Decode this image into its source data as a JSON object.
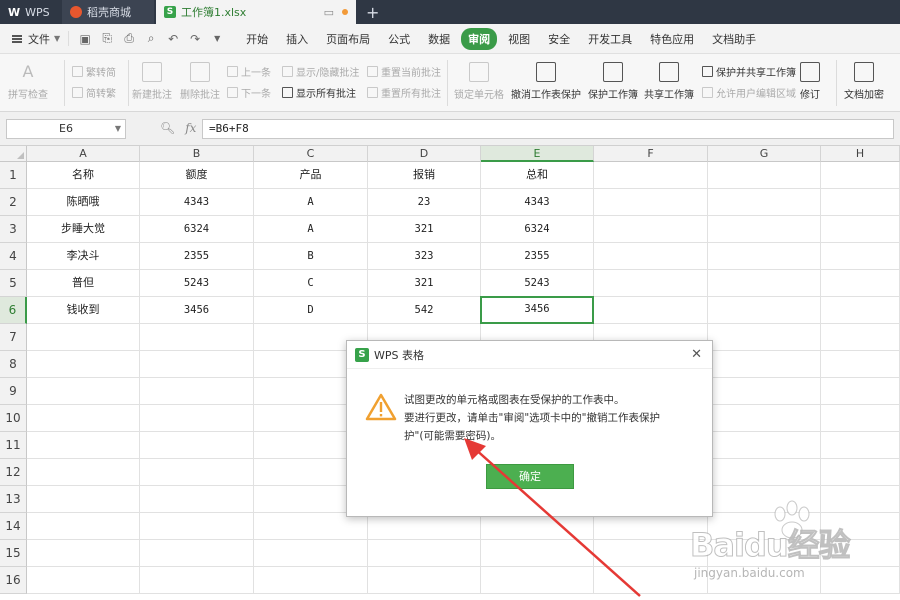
{
  "titlebar": {
    "wps_label": "WPS",
    "store_label": "稻壳商城",
    "doc_label": "工作簿1.xlsx",
    "new_tab_glyph": "+"
  },
  "menubar": {
    "file_label": "文件",
    "items": [
      "开始",
      "插入",
      "页面布局",
      "公式",
      "数据",
      "审阅",
      "视图",
      "安全",
      "开发工具",
      "特色应用",
      "文档助手"
    ],
    "active_index": 5
  },
  "ribbon": {
    "spell_check": "拼写检查",
    "trad_to_simp": "繁转简",
    "simp_to_trad": "简转繁",
    "new_comment": "新建批注",
    "delete_comment": "删除批注",
    "prev_item": "上一条",
    "next_item": "下一条",
    "show_hide_comment": "显示/隐藏批注",
    "show_all_comments": "显示所有批注",
    "reset_current_comment": "重置当前批注",
    "reset_all_comments": "重置所有批注",
    "lock_cell": "锁定单元格",
    "unprotect_sheet": "撤消工作表保护",
    "protect_workbook": "保护工作簿",
    "share_workbook": "共享工作簿",
    "protect_and_share": "保护并共享工作簿",
    "allow_edit_ranges": "允许用户编辑区域",
    "revisions": "修订",
    "encrypt_doc": "文档加密"
  },
  "formula": {
    "name_box": "E6",
    "fx": "fx",
    "value": "=B6+F8"
  },
  "sheet": {
    "columns": [
      "A",
      "B",
      "C",
      "D",
      "E",
      "F",
      "G",
      "H"
    ],
    "row_numbers": [
      "1",
      "2",
      "3",
      "4",
      "5",
      "6",
      "7",
      "8",
      "9",
      "10",
      "11",
      "12",
      "13",
      "14",
      "15",
      "16"
    ],
    "header": [
      "名称",
      "额度",
      "产品",
      "报销",
      "总和"
    ],
    "rows": [
      [
        "陈晒哦",
        "4343",
        "A",
        "23",
        "4343"
      ],
      [
        "步睡大觉",
        "6324",
        "A",
        "321",
        "6324"
      ],
      [
        "李决斗",
        "2355",
        "B",
        "323",
        "2355"
      ],
      [
        "普但",
        "5243",
        "C",
        "321",
        "5243"
      ],
      [
        "钱收到",
        "3456",
        "D",
        "542",
        "3456"
      ]
    ],
    "active_cell": "E6"
  },
  "dialog": {
    "title": "WPS 表格",
    "line1": "试图更改的单元格或图表在受保护的工作表中。",
    "line2": "要进行更改，请单击\"审阅\"选项卡中的\"撤销工作表保护",
    "line3": "护\"(可能需要密码)。",
    "ok_label": "确定",
    "close_glyph": "✕"
  },
  "watermark": {
    "brand": "Baidu经验",
    "url": "jingyan.baidu.com"
  },
  "colors": {
    "accent_green": "#3a9b48",
    "titlebar_bg": "#2f3744",
    "arrow_red": "#e53935",
    "warning_orange": "#f0a030"
  }
}
